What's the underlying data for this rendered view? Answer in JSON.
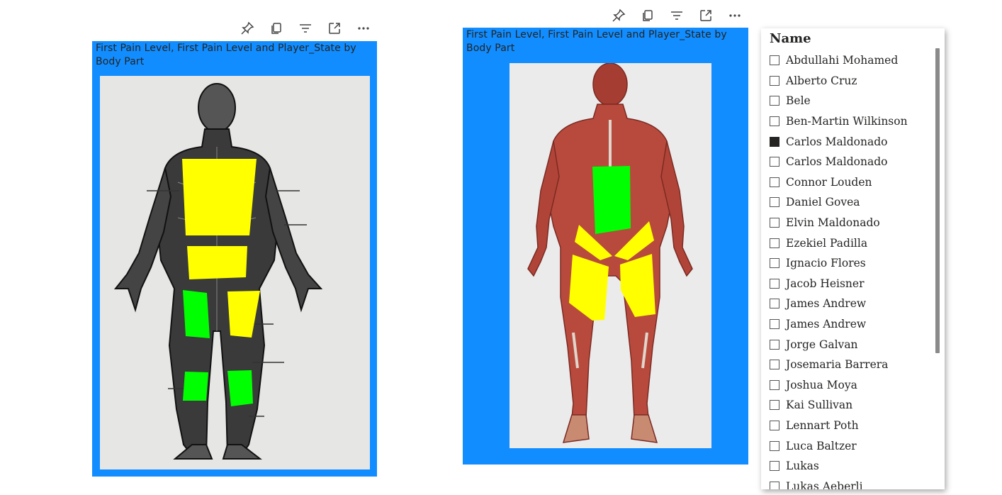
{
  "toolbar_icons": [
    "pin-icon",
    "copy-icon",
    "filter-icon",
    "focus-mode-icon",
    "more-options-icon"
  ],
  "visual_left": {
    "title": "First Pain Level, First Pain Level and Player_State by Body Part",
    "background": "#118dff",
    "regions": [
      {
        "name": "upper-back",
        "color": "#ffff00"
      },
      {
        "name": "lower-back",
        "color": "#ffff00"
      },
      {
        "name": "left-hamstring",
        "color": "#00ff00"
      },
      {
        "name": "right-hamstring",
        "color": "#ffff00"
      },
      {
        "name": "left-calf",
        "color": "#00ff00"
      },
      {
        "name": "right-calf",
        "color": "#00ff00"
      }
    ]
  },
  "visual_right": {
    "title": "First Pain Level, First Pain Level and Player_State by Body Part",
    "background": "#118dff",
    "regions": [
      {
        "name": "abdomen",
        "color": "#00ff00"
      },
      {
        "name": "left-groin",
        "color": "#ffff00"
      },
      {
        "name": "right-groin",
        "color": "#ffff00"
      },
      {
        "name": "left-quadriceps",
        "color": "#ffff00"
      },
      {
        "name": "right-quadriceps",
        "color": "#ffff00"
      }
    ]
  },
  "slicer": {
    "title": "Name",
    "items": [
      {
        "label": "Abdullahi Mohamed",
        "checked": false
      },
      {
        "label": "Alberto Cruz",
        "checked": false
      },
      {
        "label": "Bele",
        "checked": false
      },
      {
        "label": "Ben-Martin Wilkinson",
        "checked": false
      },
      {
        "label": "Carlos Maldonado",
        "checked": true
      },
      {
        "label": "Carlos Maldonado",
        "checked": false
      },
      {
        "label": "Connor Louden",
        "checked": false
      },
      {
        "label": "Daniel Govea",
        "checked": false
      },
      {
        "label": "Elvin Maldonado",
        "checked": false
      },
      {
        "label": "Ezekiel Padilla",
        "checked": false
      },
      {
        "label": "Ignacio Flores",
        "checked": false
      },
      {
        "label": "Jacob Heisner",
        "checked": false
      },
      {
        "label": "James Andrew",
        "checked": false
      },
      {
        "label": "James Andrew",
        "checked": false
      },
      {
        "label": "Jorge Galvan",
        "checked": false
      },
      {
        "label": "Josemaria Barrera",
        "checked": false
      },
      {
        "label": "Joshua Moya",
        "checked": false
      },
      {
        "label": "Kai Sullivan",
        "checked": false
      },
      {
        "label": "Lennart Poth",
        "checked": false
      },
      {
        "label": "Luca Baltzer",
        "checked": false
      },
      {
        "label": "Lukas",
        "checked": false
      },
      {
        "label": "Lukas Aeberli",
        "checked": false
      }
    ]
  }
}
